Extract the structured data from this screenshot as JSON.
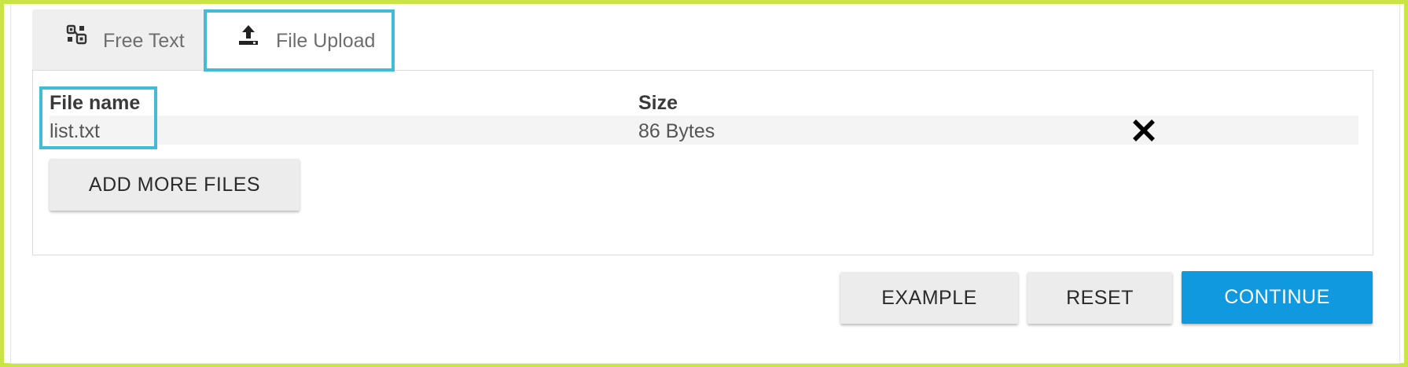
{
  "colors": {
    "accent": "#1199e0",
    "highlight": "#41bcd6",
    "outer_border": "#c9e445"
  },
  "tabs": [
    {
      "label": "Free Text",
      "icon": "free-text-icon"
    },
    {
      "label": "File Upload",
      "icon": "upload-icon"
    }
  ],
  "table": {
    "headers": {
      "name": "File name",
      "size": "Size"
    },
    "rows": [
      {
        "name": "list.txt",
        "size": "86 Bytes",
        "action_icon": "close-icon"
      }
    ]
  },
  "buttons": {
    "add_more": "ADD MORE FILES",
    "example": "EXAMPLE",
    "reset": "RESET",
    "continue": "CONTINUE"
  }
}
